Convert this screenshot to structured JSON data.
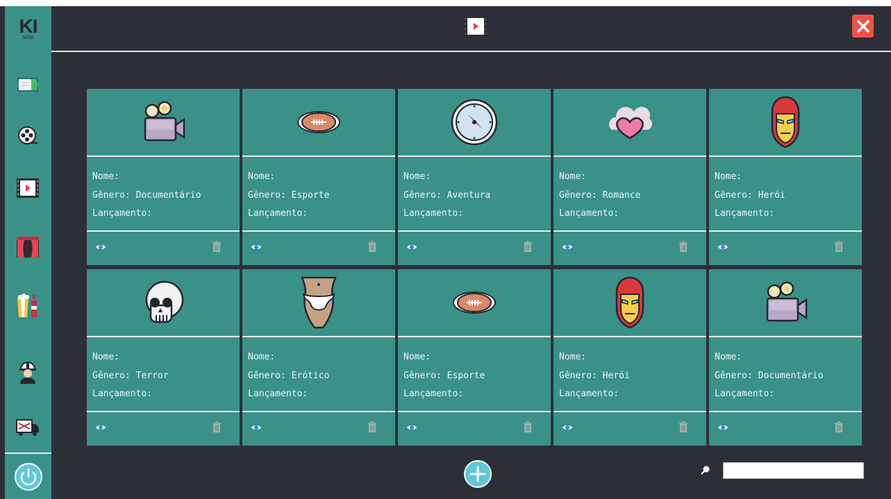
{
  "app": {
    "logo_main": "KI",
    "logo_sub": "NEMA"
  },
  "sidebar": {
    "items": [
      {
        "icon": "ticket-icon"
      },
      {
        "icon": "film-reel-icon"
      },
      {
        "icon": "film-play-icon"
      },
      {
        "icon": "theater-curtain-icon"
      },
      {
        "icon": "popcorn-soda-icon"
      },
      {
        "icon": "worker-icon"
      },
      {
        "icon": "truck-icon"
      }
    ],
    "power": "power-icon"
  },
  "header": {
    "icon": "film-play-icon",
    "close": "close-icon"
  },
  "labels": {
    "name": "Nome:",
    "genre": "Gênero:",
    "release": "Lançamento:"
  },
  "cards": [
    {
      "icon": "camera-icon",
      "name": "Nome:",
      "genre": "Gênero: Documentário",
      "release": "Lançamento:"
    },
    {
      "icon": "football-icon",
      "name": "Nome:",
      "genre": "Gênero: Esporte",
      "release": "Lançamento:"
    },
    {
      "icon": "compass-icon",
      "name": "Nome:",
      "genre": "Gênero: Aventura",
      "release": "Lançamento:"
    },
    {
      "icon": "heart-cloud-icon",
      "name": "Nome:",
      "genre": "Gênero: Romance",
      "release": "Lançamento:"
    },
    {
      "icon": "iron-mask-icon",
      "name": "Nome:",
      "genre": "Gênero: Herói",
      "release": "Lançamento:"
    },
    {
      "icon": "skull-icon",
      "name": "Nome:",
      "genre": "Gênero: Terror",
      "release": "Lançamento:"
    },
    {
      "icon": "bikini-icon",
      "name": "Nome:",
      "genre": "Gênero: Erótico",
      "release": "Lançamento:"
    },
    {
      "icon": "football-icon",
      "name": "Nome:",
      "genre": "Gênero: Esporte",
      "release": "Lançamento:"
    },
    {
      "icon": "iron-mask-icon",
      "name": "Nome:",
      "genre": "Gênero: Herói",
      "release": "Lançamento:"
    },
    {
      "icon": "camera-icon",
      "name": "Nome:",
      "genre": "Gênero: Documentário",
      "release": "Lançamento:"
    }
  ],
  "footer": {
    "add": "add-icon",
    "search_icon": "search-icon",
    "search_value": ""
  },
  "colors": {
    "bg": "#2d2f38",
    "teal": "#3a9188",
    "close_red": "#f15145"
  }
}
